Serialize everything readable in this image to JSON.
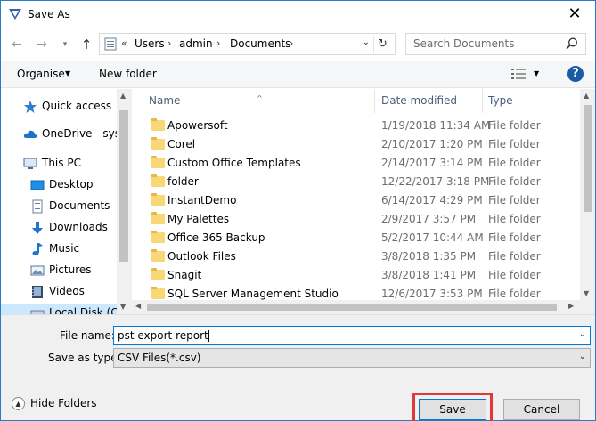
{
  "window": {
    "title": "Save As",
    "close_glyph": "✕"
  },
  "nav": {
    "back_glyph": "←",
    "forward_glyph": "→",
    "recent_glyph": "▾",
    "up_glyph": "↑"
  },
  "address": {
    "prefix": "«",
    "crumbs": [
      "Users",
      "admin",
      "Documents"
    ],
    "separator": "›",
    "dropdown_glyph": "⌄",
    "refresh_glyph": "↻"
  },
  "search": {
    "placeholder": "Search Documents"
  },
  "toolbar": {
    "organise_label": "Organise",
    "organise_arrow": "▼",
    "new_folder_label": "New folder",
    "view_arrow": "▼",
    "help_label": "?"
  },
  "sidebar": {
    "items": [
      {
        "label": "Quick access",
        "icon": "star-icon"
      },
      {
        "label": "OneDrive - syste",
        "icon": "cloud-icon"
      },
      {
        "label": "This PC",
        "icon": "computer-icon"
      },
      {
        "label": "Desktop",
        "icon": "desktop-icon"
      },
      {
        "label": "Documents",
        "icon": "documents-icon"
      },
      {
        "label": "Downloads",
        "icon": "download-icon"
      },
      {
        "label": "Music",
        "icon": "music-icon"
      },
      {
        "label": "Pictures",
        "icon": "pictures-icon"
      },
      {
        "label": "Videos",
        "icon": "videos-icon"
      },
      {
        "label": "Local Disk (C:)",
        "icon": "disk-icon"
      }
    ]
  },
  "filelist": {
    "columns": {
      "name": "Name",
      "date": "Date modified",
      "type": "Type",
      "sort_glyph": "^"
    },
    "rows": [
      {
        "name": "Apowersoft",
        "date": "1/19/2018 11:34 AM",
        "type": "File folder"
      },
      {
        "name": "Corel",
        "date": "2/10/2017 1:20 PM",
        "type": "File folder"
      },
      {
        "name": "Custom Office Templates",
        "date": "2/14/2017 3:14 PM",
        "type": "File folder"
      },
      {
        "name": "folder",
        "date": "12/22/2017 3:18 PM",
        "type": "File folder"
      },
      {
        "name": "InstantDemo",
        "date": "6/14/2017 4:29 PM",
        "type": "File folder"
      },
      {
        "name": "My Palettes",
        "date": "2/9/2017 3:57 PM",
        "type": "File folder"
      },
      {
        "name": "Office 365 Backup",
        "date": "5/2/2017 10:44 AM",
        "type": "File folder"
      },
      {
        "name": "Outlook Files",
        "date": "3/8/2018 1:35 PM",
        "type": "File folder"
      },
      {
        "name": "Snagit",
        "date": "3/8/2018 1:41 PM",
        "type": "File folder"
      },
      {
        "name": "SQL Server Management Studio",
        "date": "12/6/2017 3:53 PM",
        "type": "File folder"
      }
    ]
  },
  "scroll": {
    "up": "▲",
    "down": "▼",
    "left": "◀",
    "right": "▶"
  },
  "form": {
    "filename_label": "File name:",
    "filename_value": "pst export report",
    "savetype_label": "Save as type:",
    "savetype_value": "CSV Files(*.csv)",
    "dropdown_glyph": "⌄"
  },
  "footer": {
    "hide_folders_label": "Hide Folders",
    "hide_folders_glyph": "▲",
    "save_label": "Save",
    "cancel_label": "Cancel"
  },
  "colors": {
    "accent": "#0078d7",
    "highlight": "#e0393b",
    "folder": "#f8d775"
  }
}
